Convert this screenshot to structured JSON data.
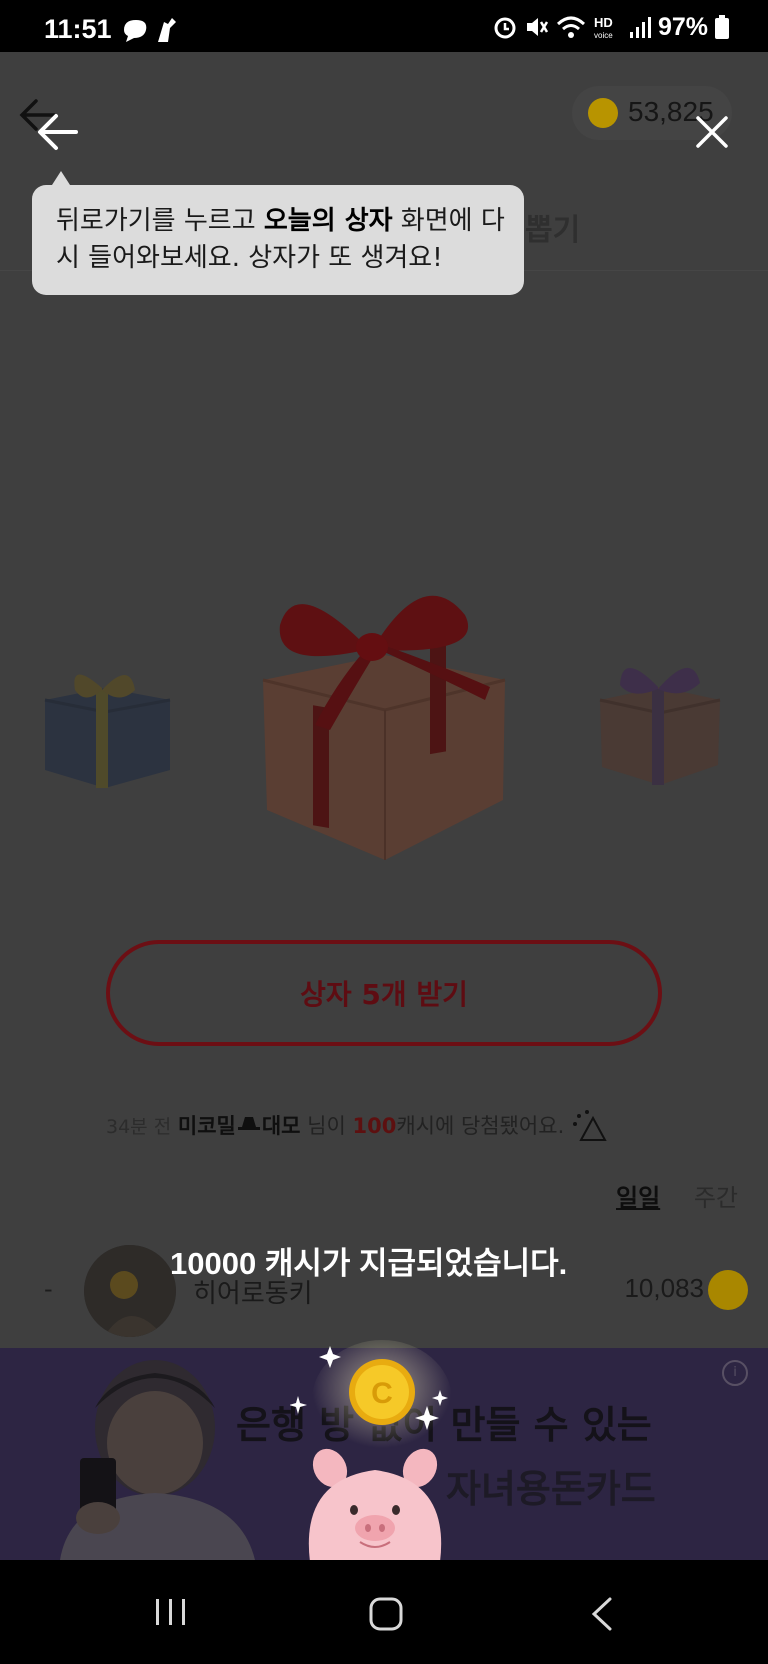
{
  "status_bar": {
    "time": "11:51",
    "battery_pct": "97%",
    "icons": [
      "alarm-icon",
      "mute-icon",
      "wifi-icon",
      "hd-voice-icon",
      "signal-icon",
      "battery-icon"
    ]
  },
  "header": {
    "coin_balance": "53,825",
    "tab_peek": "뽑기"
  },
  "tooltip": {
    "part1": "뒤로가기를 누르고 ",
    "bold": "오늘의 상자",
    "part2": " 화면에 다시 들어와보세요. 상자가 또 생겨요!"
  },
  "open_button": {
    "label": "상자 5개 받기"
  },
  "winner": {
    "ago": "34분 전",
    "nick_a": "미코밀",
    "nick_b": "대모",
    "text1": " 님이 ",
    "amount": "100",
    "text2": "캐시에 당첨됐어요."
  },
  "ranking": {
    "tab_daily": "일일",
    "tab_weekly": "주간",
    "row": {
      "rank": "-",
      "name": "히어로동키",
      "score": "10,083"
    }
  },
  "toast": {
    "message": "10000 캐시가 지급되었습니다."
  },
  "banner": {
    "line1": "은행 방      없이 만들 수 있는",
    "line2": "자녀용돈카드",
    "info": "i"
  },
  "colors": {
    "overlay": "#3f3f3f",
    "tooltip_bg": "#dcdcdc",
    "button_border": "#6c0f14",
    "coin_gold": "#f2c320",
    "banner_bg": "#2d2543"
  }
}
